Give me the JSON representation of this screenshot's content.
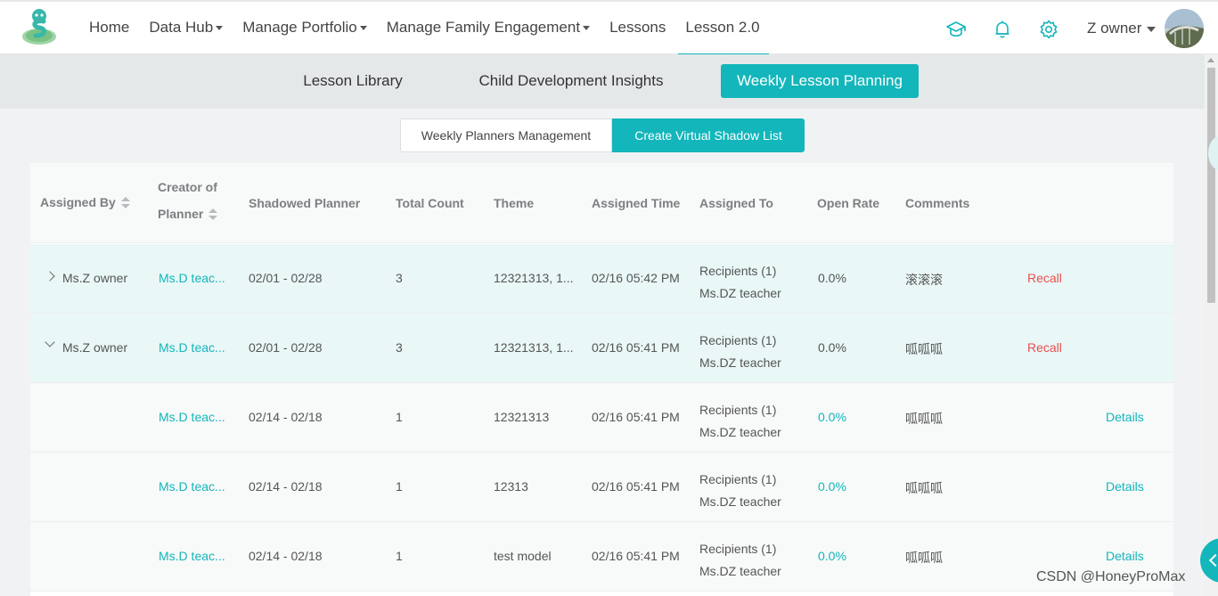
{
  "nav": {
    "items": [
      {
        "label": "Home",
        "dropdown": false,
        "active": false
      },
      {
        "label": "Data Hub",
        "dropdown": true,
        "active": false
      },
      {
        "label": "Manage Portfolio",
        "dropdown": true,
        "active": false
      },
      {
        "label": "Manage Family Engagement",
        "dropdown": true,
        "active": false
      },
      {
        "label": "Lessons",
        "dropdown": false,
        "active": false
      },
      {
        "label": "Lesson 2.0",
        "dropdown": false,
        "active": true
      }
    ],
    "icons": [
      "graduation-cap-icon",
      "bell-icon",
      "gear-icon"
    ],
    "user_name": "Z owner"
  },
  "subnav": {
    "tabs": [
      {
        "label": "Lesson Library",
        "active": false
      },
      {
        "label": "Child Development Insights",
        "active": false
      },
      {
        "label": "Weekly Lesson Planning",
        "active": true
      }
    ]
  },
  "segment": {
    "options": [
      {
        "label": "Weekly Planners Management",
        "active": false
      },
      {
        "label": "Create Virtual Shadow List",
        "active": true
      }
    ]
  },
  "table": {
    "headers": {
      "assigned_by": "Assigned By",
      "creator_line1": "Creator of",
      "creator_line2": "Planner",
      "shadowed_planner": "Shadowed Planner",
      "total_count": "Total Count",
      "theme": "Theme",
      "assigned_time": "Assigned Time",
      "assigned_to": "Assigned To",
      "open_rate": "Open Rate",
      "comments": "Comments"
    },
    "rows": [
      {
        "type": "parent",
        "expanded": false,
        "assigned_by": "Ms.Z owner",
        "creator": "Ms.D teac...",
        "planner": "02/01 - 02/28",
        "count": "3",
        "theme": "12321313, 1...",
        "time": "02/16 05:42 PM",
        "recipients": "Recipients (1)",
        "teacher": "Ms.DZ teacher",
        "open_rate": "0.0%",
        "comment": "滚滚滚",
        "action": "Recall"
      },
      {
        "type": "parent",
        "expanded": true,
        "assigned_by": "Ms.Z owner",
        "creator": "Ms.D teac...",
        "planner": "02/01 - 02/28",
        "count": "3",
        "theme": "12321313, 1...",
        "time": "02/16 05:41 PM",
        "recipients": "Recipients (1)",
        "teacher": "Ms.DZ teacher",
        "open_rate": "0.0%",
        "comment": "呱呱呱",
        "action": "Recall"
      },
      {
        "type": "child",
        "assigned_by": "",
        "creator": "Ms.D teac...",
        "planner": "02/14 - 02/18",
        "count": "1",
        "theme": "12321313",
        "time": "02/16 05:41 PM",
        "recipients": "Recipients (1)",
        "teacher": "Ms.DZ teacher",
        "open_rate": "0.0%",
        "comment": "呱呱呱",
        "action": "Details"
      },
      {
        "type": "child",
        "assigned_by": "",
        "creator": "Ms.D teac...",
        "planner": "02/14 - 02/18",
        "count": "1",
        "theme": "12313",
        "time": "02/16 05:41 PM",
        "recipients": "Recipients (1)",
        "teacher": "Ms.DZ teacher",
        "open_rate": "0.0%",
        "comment": "呱呱呱",
        "action": "Details"
      },
      {
        "type": "child",
        "assigned_by": "",
        "creator": "Ms.D teac...",
        "planner": "02/14 - 02/18",
        "count": "1",
        "theme": "test model",
        "time": "02/16 05:41 PM",
        "recipients": "Recipients (1)",
        "teacher": "Ms.DZ teacher",
        "open_rate": "0.0%",
        "comment": "呱呱呱",
        "action": "Details"
      }
    ]
  },
  "watermark": "CSDN @HoneyProMax",
  "colors": {
    "accent": "#13b6bb",
    "recall": "#e84f4f"
  }
}
